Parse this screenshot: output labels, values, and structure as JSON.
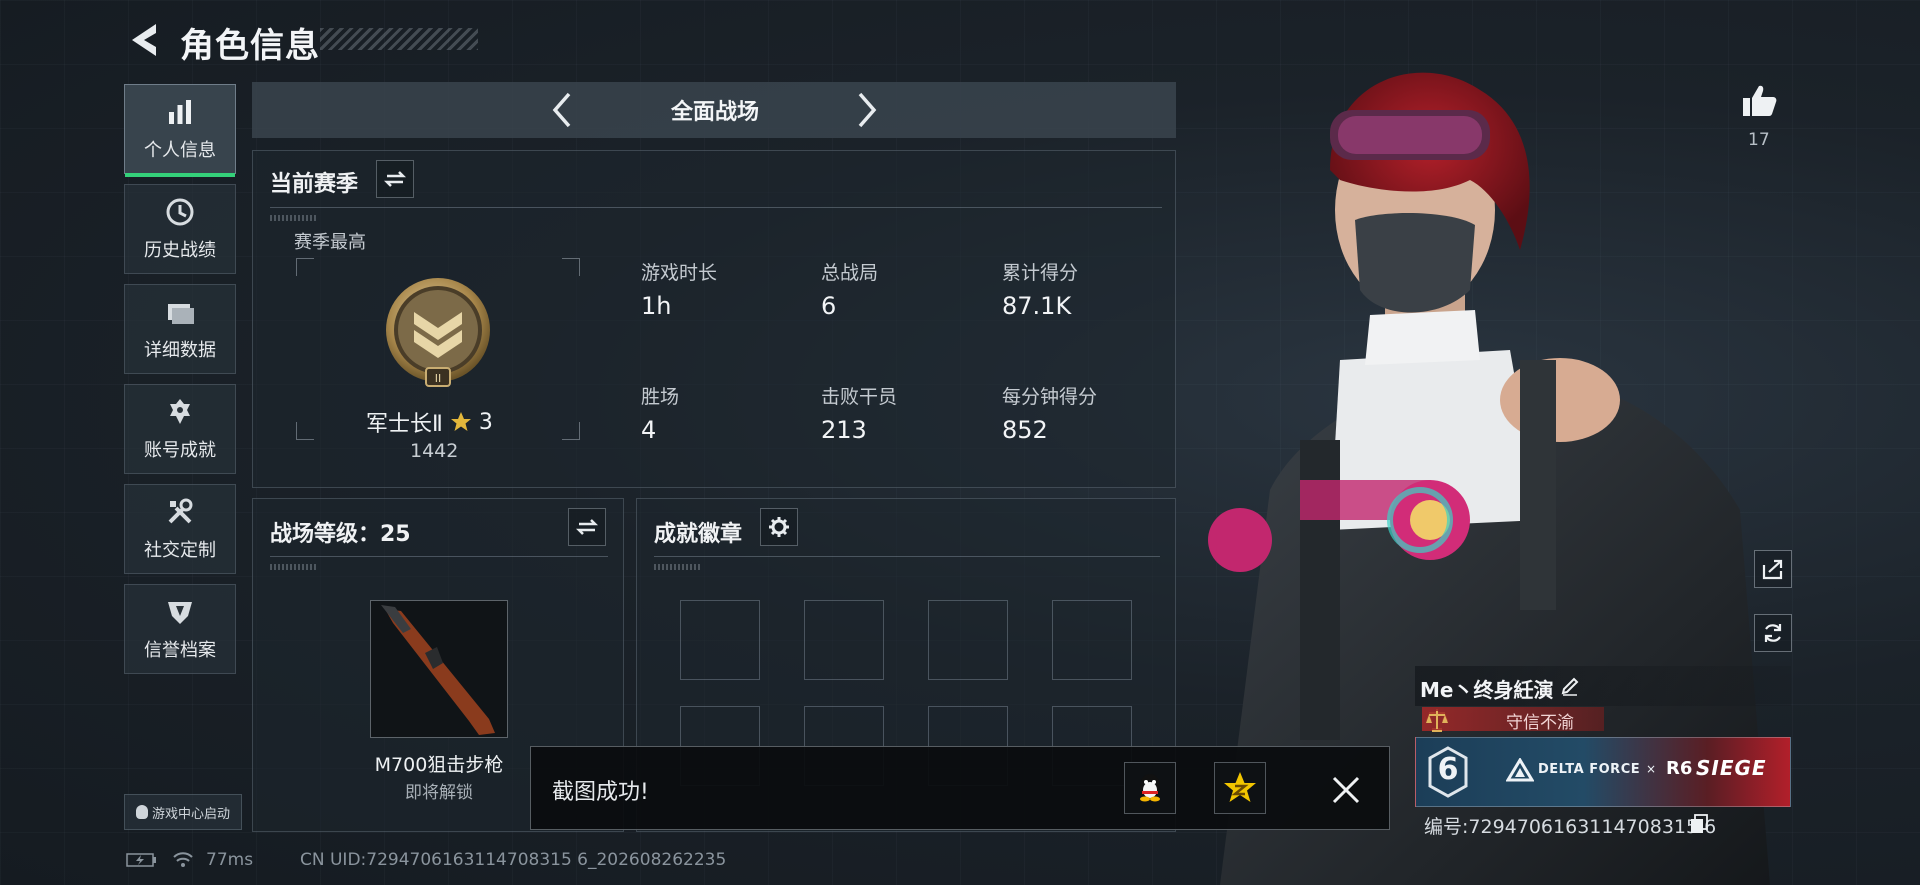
{
  "header": {
    "title": "角色信息"
  },
  "nav": {
    "items": [
      {
        "label": "个人信息",
        "icon": "bar-chart-icon",
        "active": true
      },
      {
        "label": "历史战绩",
        "icon": "clock-icon"
      },
      {
        "label": "详细数据",
        "icon": "folder-icon"
      },
      {
        "label": "账号成就",
        "icon": "achievement-icon"
      },
      {
        "label": "社交定制",
        "icon": "tools-icon"
      },
      {
        "label": "信誉档案",
        "icon": "shield-icon"
      }
    ],
    "launch_label": "游戏中心启动"
  },
  "mode": {
    "label": "全面战场"
  },
  "season": {
    "title": "当前赛季",
    "best_label": "赛季最高",
    "rank_name": "军士长Ⅱ",
    "rank_roman": "II",
    "stars": "3",
    "rank_score": "1442",
    "stats": [
      {
        "label": "游戏时长",
        "value": "1h"
      },
      {
        "label": "总战局",
        "value": "6"
      },
      {
        "label": "累计得分",
        "value": "87.1K"
      },
      {
        "label": "胜场",
        "value": "4"
      },
      {
        "label": "击败干员",
        "value": "213"
      },
      {
        "label": "每分钟得分",
        "value": "852"
      }
    ]
  },
  "battle_level": {
    "title": "战场等级：25",
    "weapon_name": "M700狙击步枪",
    "weapon_status": "即将解锁"
  },
  "badges": {
    "title": "成就徽章",
    "slot_count": 8
  },
  "toast": {
    "message": "截图成功!"
  },
  "likes": {
    "count": "17"
  },
  "player": {
    "name": "Me丶终身紝演",
    "honor": "守信不渝",
    "banner_number": "6",
    "banner_brand": "DELTA FORCE",
    "banner_x": "×",
    "banner_collab_r6": "R6",
    "banner_collab_siege": "SIEGE",
    "uid_line": "编号:7294706163114708315 6"
  },
  "status": {
    "ping": "77ms",
    "uid": "CN UID:7294706163114708315 6_202608262235"
  },
  "colors": {
    "accent_green": "#34d17a",
    "honor_red": "#a32828",
    "star_gold": "#e3b73b"
  }
}
